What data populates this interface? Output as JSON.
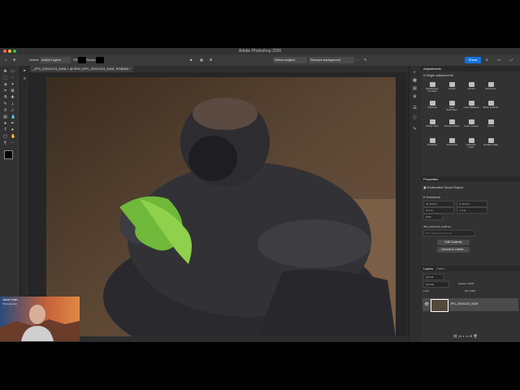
{
  "app": {
    "title": "Adobe Photoshop 2026"
  },
  "options": {
    "select_label": "Select:",
    "select_value": "Active Layers",
    "fill_label": "Fill:",
    "stroke_label": "Stroke:",
    "select_subject": "Select subject",
    "remove_background": "Remove background",
    "share": "Share"
  },
  "document": {
    "tab_title": "_JPG_20241213_5428-1 @ 59% (JPG_20241213_5428, RGB/8#) *"
  },
  "status": {
    "zoom": "59.08%"
  },
  "panels": {
    "adjustments": {
      "title": "Adjustments",
      "section": "Single adjustments",
      "items": [
        "Brightness/ Contrast",
        "Levels",
        "Curves",
        "Exposure",
        "Vibrance",
        "Hue/ Saturation",
        "Color Balance",
        "Black & White",
        "Photo Filter",
        "Channel Mixer",
        "Color Lookup",
        "Invert",
        "Posterize",
        "Threshold",
        "Selective Color",
        "Gradient Map"
      ]
    },
    "properties": {
      "title": "Properties",
      "kind": "Embedded Smart Object",
      "transform": "Transform",
      "w": "W: 21.8 in",
      "h": "H: 16.3 in",
      "x": "X: 0 in",
      "y": "Y: 0 in",
      "angle": "0.00°",
      "filename": "JPG_20241213_5428.psf",
      "layer_comp": "Don't Apply Layer Comp",
      "edit_contents": "Edit Contents",
      "convert_to_linked": "Convert to Linked..."
    },
    "layers": {
      "tabs": [
        "Layers",
        "Paths"
      ],
      "kind": "Q Kind",
      "blend": "Normal",
      "opacity": "Opacity: 100%",
      "lock": "Lock:",
      "fill": "Fill: 100%",
      "layer_name": "JPG_20241213_5428"
    }
  },
  "webcam": {
    "name": "Jason Hoch",
    "subtitle": "Photographer"
  },
  "colors": {
    "accent": "#1473e6",
    "active_layer": "#4b4b4b",
    "panel_bg": "#323232"
  }
}
